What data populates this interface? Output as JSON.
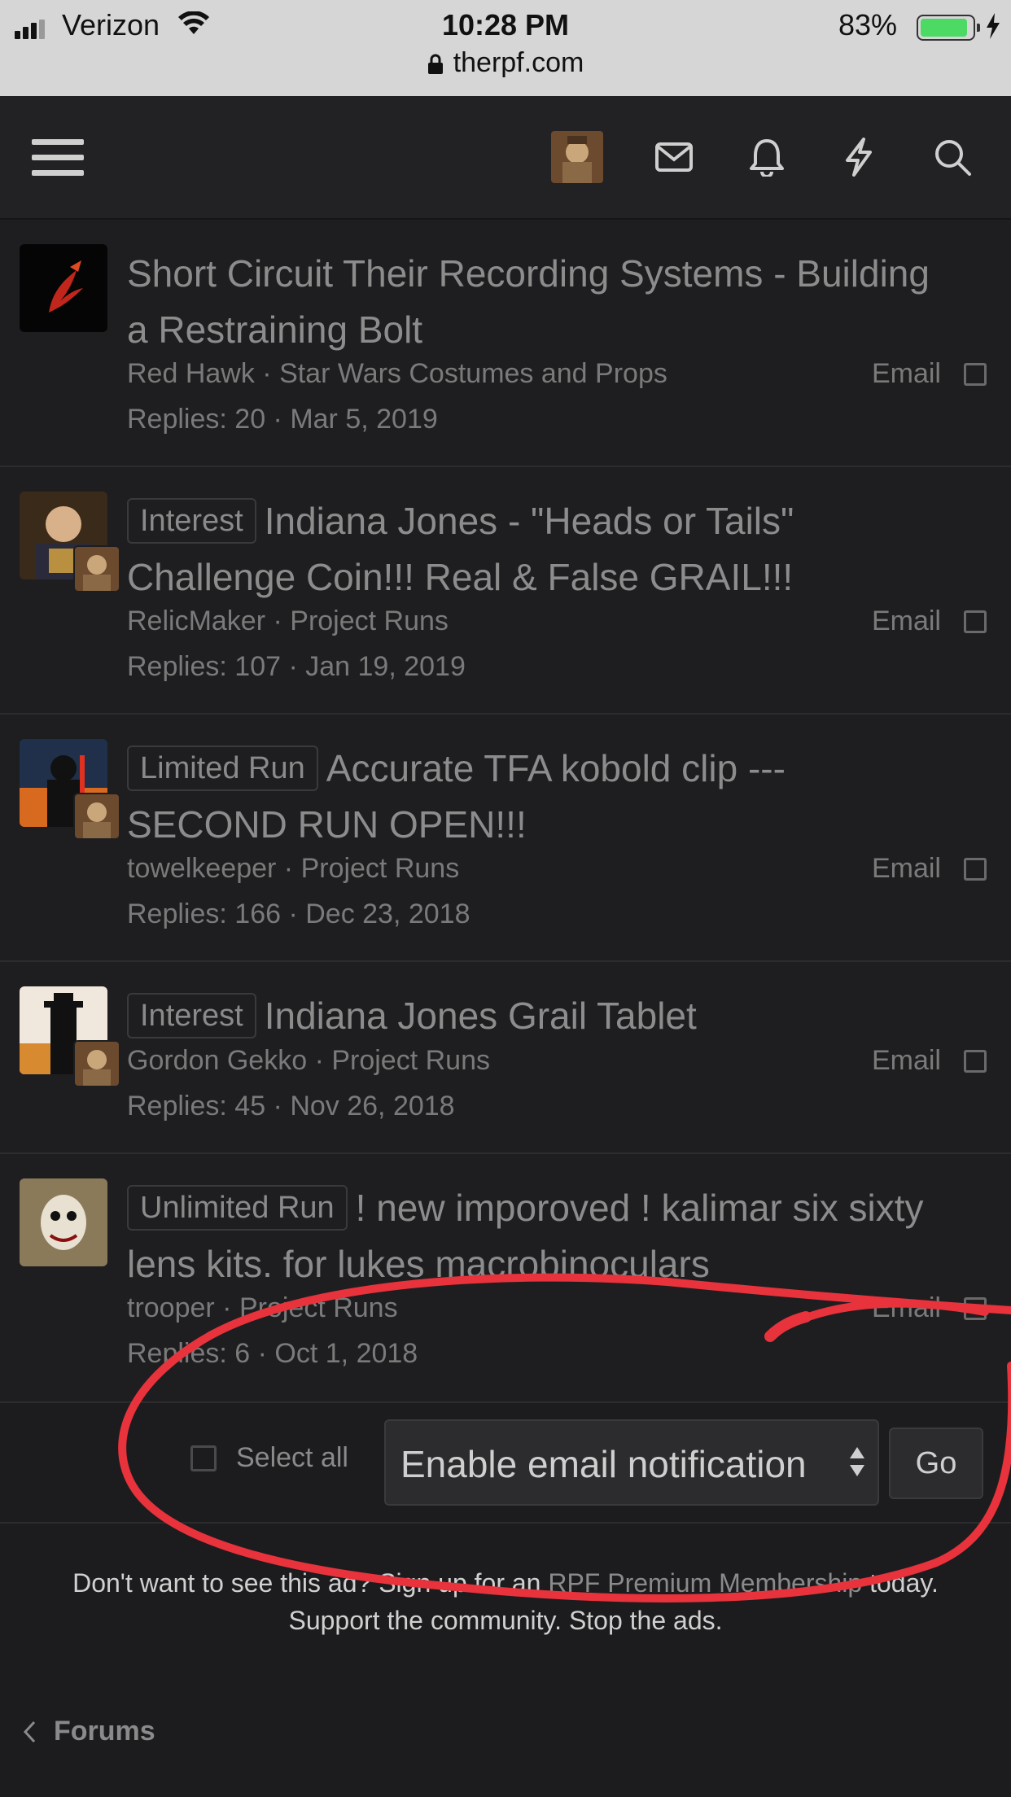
{
  "status_bar": {
    "carrier": "Verizon",
    "time": "10:28 PM",
    "battery_percent": "83%",
    "battery_level": 0.83,
    "url": "therpf.com"
  },
  "nav": {
    "icons": [
      "menu-icon",
      "user-avatar",
      "mail-icon",
      "bell-icon",
      "bolt-icon",
      "search-icon"
    ]
  },
  "threads": [
    {
      "prefix": "",
      "title": "Short Circuit Their Recording Systems - Building a Restraining Bolt",
      "author": "Red Hawk",
      "forum": "Star Wars Costumes and Props",
      "replies": "Replies: 20",
      "date": "Mar 5, 2019",
      "email_label": "Email"
    },
    {
      "prefix": "Interest",
      "title": "Indiana Jones - \"Heads or Tails\" Challenge Coin!!! Real & False GRAIL!!!",
      "author": "RelicMaker",
      "forum": "Project Runs",
      "replies": "Replies: 107",
      "date": "Jan 19, 2019",
      "email_label": "Email"
    },
    {
      "prefix": "Limited Run",
      "title": "Accurate TFA kobold clip --- SECOND RUN OPEN!!!",
      "author": "towelkeeper",
      "forum": "Project Runs",
      "replies": "Replies: 166",
      "date": "Dec 23, 2018",
      "email_label": "Email"
    },
    {
      "prefix": "Interest",
      "title": "Indiana Jones Grail Tablet",
      "author": "Gordon Gekko",
      "forum": "Project Runs",
      "replies": "Replies: 45",
      "date": "Nov 26, 2018",
      "email_label": "Email"
    },
    {
      "prefix": "Unlimited Run",
      "title": "! new imporoved ! kalimar six sixty lens kits. for lukes macrobinoculars",
      "author": "trooper",
      "forum": "Project Runs",
      "replies": "Replies: 6",
      "date": "Oct 1, 2018",
      "email_label": "Email"
    }
  ],
  "actions": {
    "select_all_label": "Select all",
    "selected_action": "Enable email notification",
    "go_label": "Go"
  },
  "ad": {
    "line1_before": "Don't want to see this ad? Sign up for an ",
    "link": "RPF Premium Membership",
    "line1_after": " today.",
    "line2": "Support the community. Stop the ads."
  },
  "breadcrumb": {
    "label": "Forums"
  },
  "colors": {
    "background": "#1c1c1e",
    "navbar": "#222224",
    "annotation": "#e8323c",
    "battery": "#4cd964"
  }
}
